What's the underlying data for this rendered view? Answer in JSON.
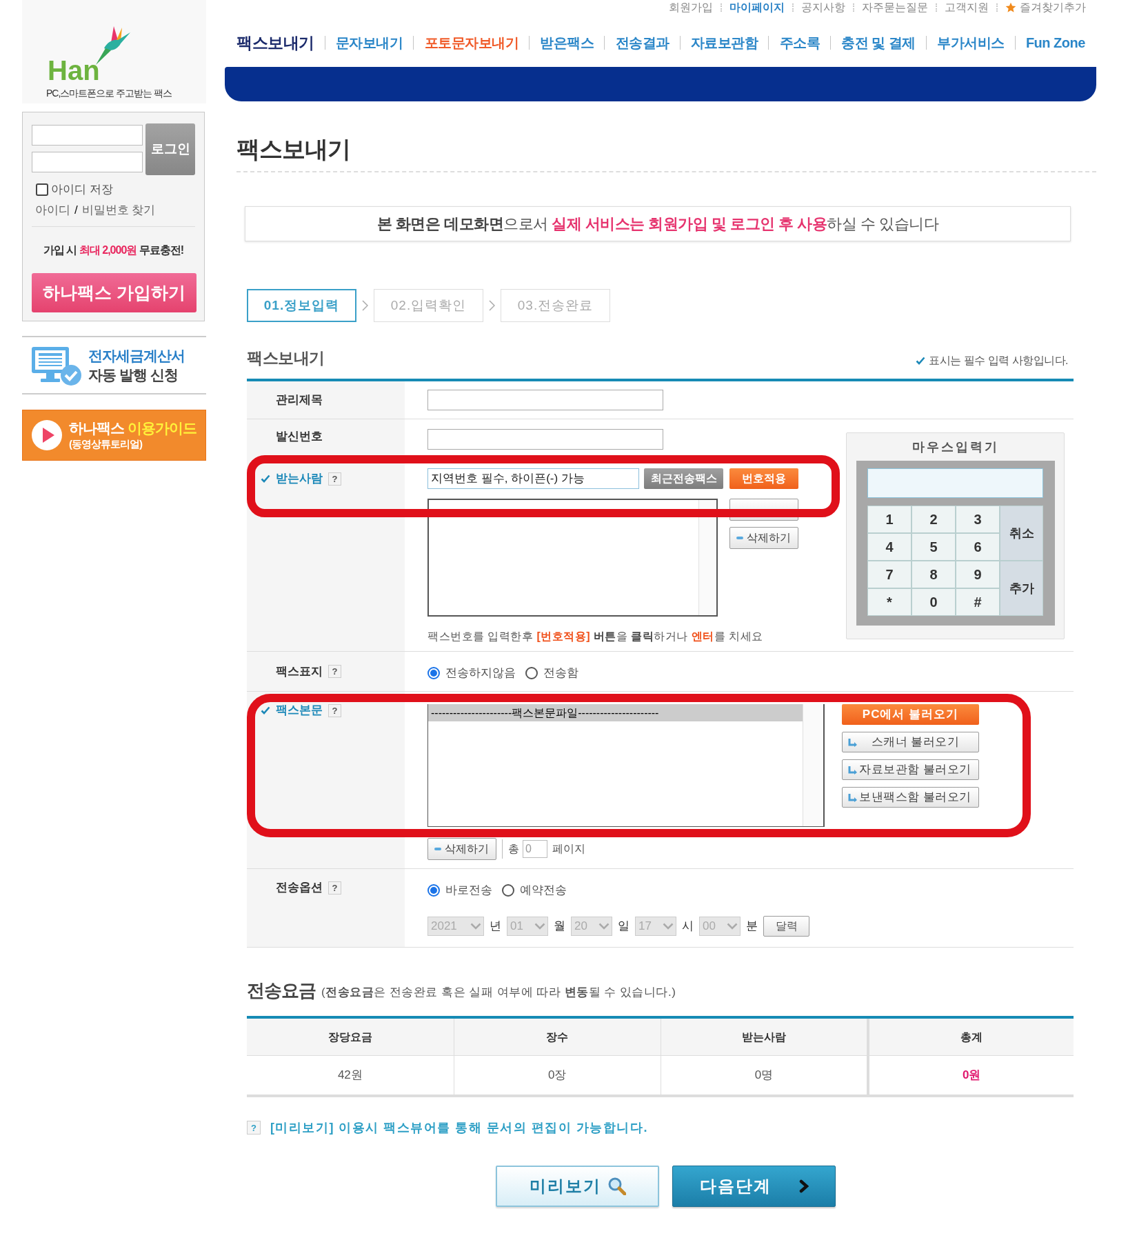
{
  "header": {
    "logo": {
      "text": "Han",
      "tagline": "PC,스마트폰으로 주고받는 팩스"
    },
    "top_links": [
      {
        "label": "회원가입",
        "kind": "normal"
      },
      {
        "label": "마이페이지",
        "kind": "highlight"
      },
      {
        "label": "공지사항",
        "kind": "normal"
      },
      {
        "label": "자주묻는질문",
        "kind": "normal"
      },
      {
        "label": "고객지원",
        "kind": "normal"
      },
      {
        "label": "즐겨찾기추가",
        "kind": "bookmark"
      }
    ],
    "nav": [
      {
        "label": "팩스보내기",
        "selected": true,
        "kind": "normal"
      },
      {
        "label": "문자보내기",
        "selected": false,
        "kind": "normal"
      },
      {
        "label": "포토문자보내기",
        "selected": false,
        "kind": "hot"
      },
      {
        "label": "받은팩스",
        "selected": false,
        "kind": "normal"
      },
      {
        "label": "전송결과",
        "selected": false,
        "kind": "normal"
      },
      {
        "label": "자료보관함",
        "selected": false,
        "kind": "normal"
      },
      {
        "label": "주소록",
        "selected": false,
        "kind": "normal"
      },
      {
        "label": "충전 및 결제",
        "selected": false,
        "kind": "normal"
      },
      {
        "label": "부가서비스",
        "selected": false,
        "kind": "normal"
      },
      {
        "label": "Fun Zone",
        "selected": false,
        "kind": "normal"
      }
    ]
  },
  "sidebar": {
    "login": {
      "button": "로그인",
      "remember": {
        "label": "아이디 저장",
        "checked": false
      },
      "find_links": [
        "아이디",
        "비밀번호 찾기"
      ],
      "find_separator": "/"
    },
    "promo": [
      {
        "text": "가입 시 ",
        "kind": "plain"
      },
      {
        "text": "최대 2,000원",
        "kind": "accent"
      },
      {
        "text": " 무료충전!",
        "kind": "plain"
      }
    ],
    "join_button": "하나팩스 가입하기",
    "tax_banner": {
      "title": "전자세금계산서",
      "subtitle": "자동 발행 신청"
    },
    "guide_banner": {
      "title": [
        {
          "text": "하나팩스 ",
          "kind": "plain"
        },
        {
          "text": "이용가이드",
          "kind": "accent"
        }
      ],
      "subtitle": "(동영상튜토리얼)"
    }
  },
  "page": {
    "title": "팩스보내기",
    "notice": [
      {
        "text": "본 화면은 데모화면",
        "kind": "strong"
      },
      {
        "text": "으로서 ",
        "kind": "plain"
      },
      {
        "text": "실제 서비스는 회원가입 및 로그인 후 사용",
        "kind": "accent"
      },
      {
        "text": "하실 수 있습니다",
        "kind": "plain"
      }
    ],
    "steps": [
      {
        "label": "01.정보입력",
        "selected": true
      },
      {
        "label": "02.입력확인",
        "selected": false
      },
      {
        "label": "03.전송완료",
        "selected": false
      }
    ]
  },
  "form": {
    "title": "팩스보내기",
    "required_note": "표시는 필수 입력 사항입니다.",
    "subject": {
      "label": "관리제목",
      "required": false
    },
    "sender": {
      "label": "발신번호",
      "required": false
    },
    "recipient": {
      "label": "받는사람",
      "required": true,
      "help": "?",
      "highlighted": true,
      "placeholder": "지역번호 필수, 하이픈(-) 가능",
      "recent_button": "최근전송팩스",
      "apply_button": "번호적용",
      "delete_button": "삭제하기",
      "hint": [
        {
          "text": "팩스번호를 입력한후 ",
          "kind": "plain"
        },
        {
          "text": "[번호적용]",
          "kind": "accent"
        },
        {
          "text": " 버튼",
          "kind": "strong"
        },
        {
          "text": "을 ",
          "kind": "plain"
        },
        {
          "text": "클릭",
          "kind": "strong"
        },
        {
          "text": "하거나 ",
          "kind": "plain"
        },
        {
          "text": "엔터",
          "kind": "accent"
        },
        {
          "text": "를 치세요",
          "kind": "plain"
        }
      ]
    },
    "keypad": {
      "title": "마우스입력기",
      "keys": [
        "1",
        "2",
        "3",
        "4",
        "5",
        "6",
        "7",
        "8",
        "9",
        "*",
        "0",
        "#"
      ],
      "side_keys": [
        "취소",
        "추가"
      ]
    },
    "cover": {
      "label": "팩스표지",
      "required": false,
      "help": "?",
      "options": [
        {
          "label": "전송하지않음",
          "selected": true
        },
        {
          "label": "전송함",
          "selected": false
        }
      ]
    },
    "body": {
      "label": "팩스본문",
      "required": true,
      "help": "?",
      "highlighted": true,
      "files": [
        {
          "name": "----------------------팩스본문파일----------------------",
          "selected": true
        }
      ],
      "load_buttons": [
        {
          "label": "PC에서 불러오기",
          "kind": "primary"
        },
        {
          "label": "스캐너 불러오기",
          "kind": "import"
        },
        {
          "label": "자료보관함 불러오기",
          "kind": "import"
        },
        {
          "label": "보낸팩스함 불러오기",
          "kind": "import"
        }
      ],
      "delete_button": "삭제하기",
      "pages_prefix": "총",
      "pages_value": "0",
      "pages_suffix": "페이지"
    },
    "schedule": {
      "label": "전송옵션",
      "required": false,
      "help": "?",
      "options": [
        {
          "label": "바로전송",
          "selected": true
        },
        {
          "label": "예약전송",
          "selected": false
        }
      ],
      "disabled": true,
      "date_parts": [
        {
          "value": "2021",
          "unit": "년"
        },
        {
          "value": "01",
          "unit": "월"
        },
        {
          "value": "20",
          "unit": "일"
        },
        {
          "value": "17",
          "unit": "시"
        },
        {
          "value": "00",
          "unit": "분"
        }
      ],
      "calendar_button": "달력"
    }
  },
  "fees": {
    "title": "전송요금",
    "note": "(**전송요금**은 전송완료 혹은 실패 여부에 따라 **변동**될 수 있습니다.)",
    "columns": [
      "장당요금",
      "장수",
      "받는사람",
      "총계"
    ],
    "values": [
      {
        "text": "42원",
        "kind": "normal"
      },
      {
        "text": "0장",
        "kind": "normal"
      },
      {
        "text": "0명",
        "kind": "normal"
      },
      {
        "text": "0원",
        "kind": "total"
      }
    ]
  },
  "preview_note": {
    "mark": "?",
    "text": "[미리보기] 이용시 팩스뷰어를 통해 문서의 편집이 가능합니다."
  },
  "actions": [
    {
      "label": "미리보기",
      "kind": "preview"
    },
    {
      "label": "다음단계",
      "kind": "next"
    }
  ]
}
